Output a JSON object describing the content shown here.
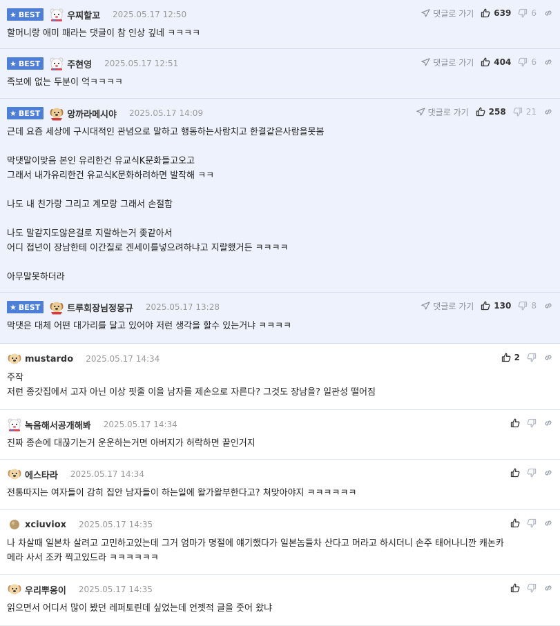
{
  "labels": {
    "best": "BEST",
    "reply": "댓글로 가기"
  },
  "comments": [
    {
      "best": true,
      "nick": "우찌할꼬",
      "date": "2025.05.17 12:50",
      "up": "639",
      "down": "6",
      "text": "할머니랑 애미 패라는 댓글이 참 인상 깊네 ㅋㅋㅋㅋ",
      "avatar": "bear"
    },
    {
      "best": true,
      "nick": "주현영",
      "date": "2025.05.17 12:51",
      "up": "404",
      "down": "6",
      "text": "족보에 없는 두분이 억ㅋㅋㅋㅋ",
      "avatar": "bear"
    },
    {
      "best": true,
      "nick": "앙까라메시야",
      "date": "2025.05.17 14:09",
      "up": "258",
      "down": "21",
      "text": "근데 요즘 세상에 구시대적인 관념으로 말하고 행동하는사람치고 한결같은사람을못봄\n\n막댓말이맞음 본인 유리한건 유교식K문화들고오고\n그래서 내가유리한건 유교식K문화하려하면 발작해 ㅋㅋ\n\n나도 내 친가랑 그리고 계모랑 그래서 손절함\n\n나도 말같지도않은걸로 지랄하는거 좆같아서\n어디 접년이 장남한테 이간질로 겐세이를넣으려하냐고 지랄했거든 ㅋㅋㅋㅋ\n\n아무말못하더라",
      "avatar": "dog-red"
    },
    {
      "best": true,
      "nick": "트루회장님정몽규",
      "date": "2025.05.17 13:28",
      "up": "130",
      "down": "8",
      "text": "막댓은 대체 어떤 대가리를 달고 있어야 저런 생각을 할수 있는거냐 ㅋㅋㅋㅋ",
      "avatar": "dog-red"
    },
    {
      "best": false,
      "nick": "mustardo",
      "date": "2025.05.17 14:34",
      "up": "2",
      "down": "",
      "text": "주작\n저런 종갓집에서 고자 아닌 이상 핏줄 이을 남자를 제손으로 자른다? 그것도 장남을? 일관성 떨어짐",
      "avatar": "dog"
    },
    {
      "best": false,
      "nick": "녹음해서공개해봐",
      "date": "2025.05.17 14:34",
      "up": "",
      "down": "",
      "text": "진짜 종손에 대끊기는거 운운하는거면 아버지가 허락하면 끝인거지",
      "avatar": "bear"
    },
    {
      "best": false,
      "nick": "에스타라",
      "date": "2025.05.17 14:34",
      "up": "",
      "down": "",
      "text": "전통따지는 여자들이 감히 집안 남자들이 하는일에 왈가왈부한다고? 쳐맞아야지 ㅋㅋㅋㅋㅋㅋ",
      "avatar": "dog"
    },
    {
      "best": false,
      "nick": "xciuviox",
      "date": "2025.05.17 14:35",
      "up": "",
      "down": "",
      "text": "나 차살때 일본차 살려고 고민하고있는데 그거 엄마가 명절에 얘기했다가 일본놈들차 산다고 머라고 하시더니 손주 태어나니깐 캐논카\n메라 사서 조카 찍고있드라 ㅋㅋㅋㅋㅋㅋ",
      "avatar": "dot"
    },
    {
      "best": false,
      "nick": "우리뿌옹이",
      "date": "2025.05.17 14:35",
      "up": "",
      "down": "",
      "text": "읽으면서 어디서 많이 봤던 레퍼토린데 싶었는데 언젯적 글을 줏어 왔냐",
      "avatar": "dog"
    }
  ],
  "colors": {
    "best_bg": "#edf2fc",
    "badge": "#4e7fd8",
    "text": "#222222",
    "muted": "#9a9a9a"
  }
}
